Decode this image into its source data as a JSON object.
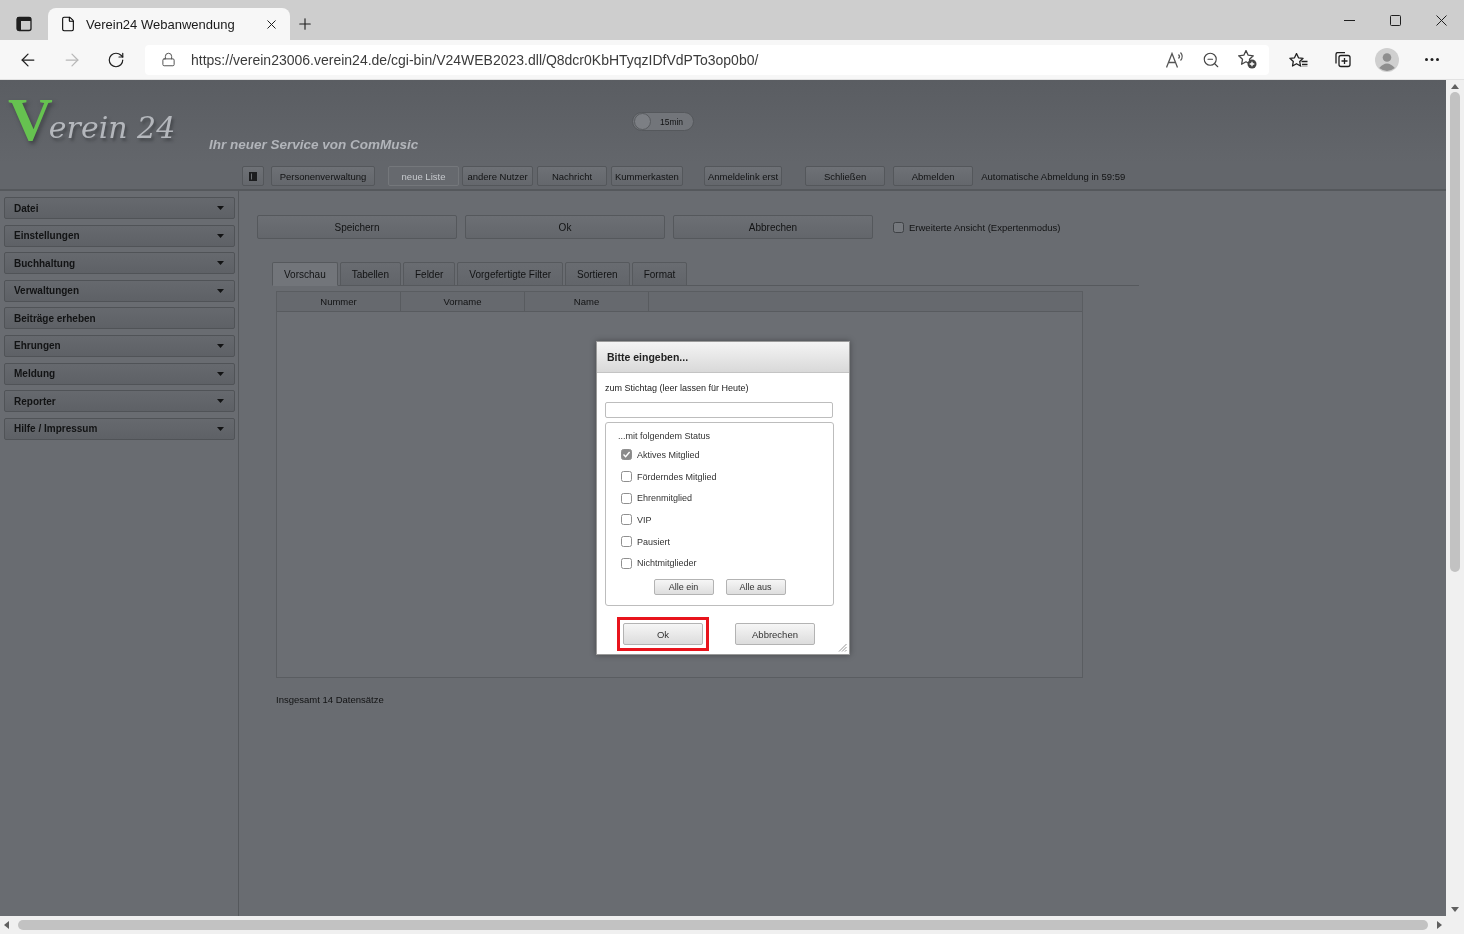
{
  "browser": {
    "tab_title": "Verein24 Webanwendung",
    "url": "https://verein23006.verein24.de/cgi-bin/V24WEB2023.dll/Q8dcr0KbHTyqzIDfVdPTo3op0b0/",
    "forward_disabled": true
  },
  "header": {
    "logo": {
      "initial": "V",
      "rest": "erein 24"
    },
    "slogan": "Ihr neuer Service von ComMusic",
    "timer_toggle": {
      "label": "15min",
      "on": false
    }
  },
  "toolbar": {
    "buttons": [
      {
        "kind": "icon",
        "disabled": false
      },
      {
        "kind": "text",
        "label": "Personenverwaltung",
        "disabled": false
      },
      {
        "kind": "text",
        "label": "neue Liste",
        "disabled": true
      },
      {
        "kind": "text",
        "label": "andere Nutzer",
        "disabled": false
      },
      {
        "kind": "text",
        "label": "Nachricht",
        "disabled": false
      },
      {
        "kind": "text",
        "label": "Kummerkasten",
        "disabled": false
      },
      {
        "kind": "text",
        "label": "Anmeldelink erst",
        "disabled": false
      },
      {
        "kind": "text",
        "label": "Schließen",
        "disabled": false
      },
      {
        "kind": "text",
        "label": "Abmelden",
        "disabled": false
      }
    ],
    "logout_notice": "Automatische Abmeldung in 59:59"
  },
  "sidebar": {
    "items": [
      {
        "label": "Datei",
        "kind": "menu"
      },
      {
        "label": "Einstellungen",
        "kind": "menu"
      },
      {
        "label": "Buchhaltung",
        "kind": "menu"
      },
      {
        "label": "Verwaltungen",
        "kind": "menu"
      },
      {
        "label": "Beiträge erheben",
        "kind": "link"
      },
      {
        "label": "Ehrungen",
        "kind": "menu"
      },
      {
        "label": "Meldung",
        "kind": "menu"
      },
      {
        "label": "Reporter",
        "kind": "menu"
      },
      {
        "label": "Hilfe / Impressum",
        "kind": "menu"
      }
    ]
  },
  "actions": {
    "buttons": [
      "Speichern",
      "Ok",
      "Abbrechen"
    ],
    "expert_mode": {
      "label": "Erweiterte Ansicht (Expertenmodus)",
      "checked": false
    }
  },
  "tabs": [
    {
      "label": "Vorschau",
      "selected": true
    },
    {
      "label": "Tabellen",
      "selected": false
    },
    {
      "label": "Felder",
      "selected": false
    },
    {
      "label": "Vorgefertigte Filter",
      "selected": false
    },
    {
      "label": "Sortieren",
      "selected": false
    },
    {
      "label": "Format",
      "selected": false
    }
  ],
  "table": {
    "columns": [
      "Nummer",
      "Vorname",
      "Name"
    ]
  },
  "record_count": "Insgesamt 14 Datensätze",
  "dialog": {
    "title": "Bitte eingeben...",
    "date_label": "zum Stichtag (leer lassen für Heute)",
    "status_group": {
      "legend": "...mit folgendem Status",
      "options": [
        {
          "label": "Aktives Mitglied",
          "checked": true
        },
        {
          "label": "Förderndes Mitglied",
          "checked": false
        },
        {
          "label": "Ehrenmitglied",
          "checked": false
        },
        {
          "label": "VIP",
          "checked": false
        },
        {
          "label": "Pausiert",
          "checked": false
        },
        {
          "label": "Nichtmitglieder",
          "checked": false
        }
      ],
      "buttons": [
        "Alle ein",
        "Alle aus"
      ]
    },
    "buttons": [
      {
        "label": "Ok",
        "highlighted": true
      },
      {
        "label": "Abbrechen",
        "highlighted": false
      }
    ]
  }
}
